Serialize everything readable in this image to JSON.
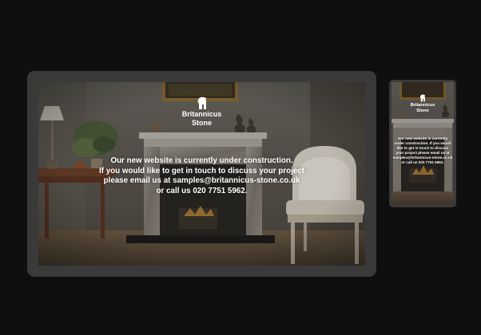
{
  "brand": {
    "line1": "Britannicus",
    "line2": "Stone"
  },
  "message": {
    "desktop_lines": [
      "Our new website is currently under construction.",
      "If you would like to get in touch to discuss your project",
      "please email us at samples@britannicus-stone.co.uk",
      "or call us 020 7751 5962."
    ],
    "mobile_lines": [
      "Our new website is currently",
      "under construction. If you would",
      "like to get in touch to discuss",
      "your project please email us at",
      "samples@britannicus-stone.co.uk",
      "or call us 020 7751 5962."
    ]
  },
  "icons": {
    "logo": "spartan-helmet-icon"
  },
  "colors": {
    "background": "#0f0f0f",
    "device_frame": "#3a3a3a",
    "text": "#ffffff"
  }
}
